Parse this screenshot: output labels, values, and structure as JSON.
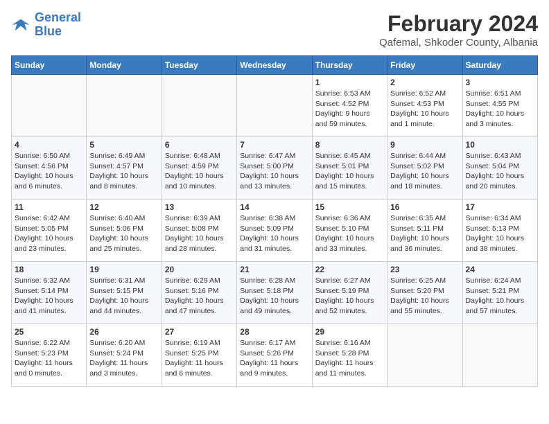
{
  "header": {
    "logo_line1": "General",
    "logo_line2": "Blue",
    "month_year": "February 2024",
    "location": "Qafemal, Shkoder County, Albania"
  },
  "days_of_week": [
    "Sunday",
    "Monday",
    "Tuesday",
    "Wednesday",
    "Thursday",
    "Friday",
    "Saturday"
  ],
  "weeks": [
    [
      {
        "day": "",
        "info": ""
      },
      {
        "day": "",
        "info": ""
      },
      {
        "day": "",
        "info": ""
      },
      {
        "day": "",
        "info": ""
      },
      {
        "day": "1",
        "info": "Sunrise: 6:53 AM\nSunset: 4:52 PM\nDaylight: 9 hours\nand 59 minutes."
      },
      {
        "day": "2",
        "info": "Sunrise: 6:52 AM\nSunset: 4:53 PM\nDaylight: 10 hours\nand 1 minute."
      },
      {
        "day": "3",
        "info": "Sunrise: 6:51 AM\nSunset: 4:55 PM\nDaylight: 10 hours\nand 3 minutes."
      }
    ],
    [
      {
        "day": "4",
        "info": "Sunrise: 6:50 AM\nSunset: 4:56 PM\nDaylight: 10 hours\nand 6 minutes."
      },
      {
        "day": "5",
        "info": "Sunrise: 6:49 AM\nSunset: 4:57 PM\nDaylight: 10 hours\nand 8 minutes."
      },
      {
        "day": "6",
        "info": "Sunrise: 6:48 AM\nSunset: 4:59 PM\nDaylight: 10 hours\nand 10 minutes."
      },
      {
        "day": "7",
        "info": "Sunrise: 6:47 AM\nSunset: 5:00 PM\nDaylight: 10 hours\nand 13 minutes."
      },
      {
        "day": "8",
        "info": "Sunrise: 6:45 AM\nSunset: 5:01 PM\nDaylight: 10 hours\nand 15 minutes."
      },
      {
        "day": "9",
        "info": "Sunrise: 6:44 AM\nSunset: 5:02 PM\nDaylight: 10 hours\nand 18 minutes."
      },
      {
        "day": "10",
        "info": "Sunrise: 6:43 AM\nSunset: 5:04 PM\nDaylight: 10 hours\nand 20 minutes."
      }
    ],
    [
      {
        "day": "11",
        "info": "Sunrise: 6:42 AM\nSunset: 5:05 PM\nDaylight: 10 hours\nand 23 minutes."
      },
      {
        "day": "12",
        "info": "Sunrise: 6:40 AM\nSunset: 5:06 PM\nDaylight: 10 hours\nand 25 minutes."
      },
      {
        "day": "13",
        "info": "Sunrise: 6:39 AM\nSunset: 5:08 PM\nDaylight: 10 hours\nand 28 minutes."
      },
      {
        "day": "14",
        "info": "Sunrise: 6:38 AM\nSunset: 5:09 PM\nDaylight: 10 hours\nand 31 minutes."
      },
      {
        "day": "15",
        "info": "Sunrise: 6:36 AM\nSunset: 5:10 PM\nDaylight: 10 hours\nand 33 minutes."
      },
      {
        "day": "16",
        "info": "Sunrise: 6:35 AM\nSunset: 5:11 PM\nDaylight: 10 hours\nand 36 minutes."
      },
      {
        "day": "17",
        "info": "Sunrise: 6:34 AM\nSunset: 5:13 PM\nDaylight: 10 hours\nand 38 minutes."
      }
    ],
    [
      {
        "day": "18",
        "info": "Sunrise: 6:32 AM\nSunset: 5:14 PM\nDaylight: 10 hours\nand 41 minutes."
      },
      {
        "day": "19",
        "info": "Sunrise: 6:31 AM\nSunset: 5:15 PM\nDaylight: 10 hours\nand 44 minutes."
      },
      {
        "day": "20",
        "info": "Sunrise: 6:29 AM\nSunset: 5:16 PM\nDaylight: 10 hours\nand 47 minutes."
      },
      {
        "day": "21",
        "info": "Sunrise: 6:28 AM\nSunset: 5:18 PM\nDaylight: 10 hours\nand 49 minutes."
      },
      {
        "day": "22",
        "info": "Sunrise: 6:27 AM\nSunset: 5:19 PM\nDaylight: 10 hours\nand 52 minutes."
      },
      {
        "day": "23",
        "info": "Sunrise: 6:25 AM\nSunset: 5:20 PM\nDaylight: 10 hours\nand 55 minutes."
      },
      {
        "day": "24",
        "info": "Sunrise: 6:24 AM\nSunset: 5:21 PM\nDaylight: 10 hours\nand 57 minutes."
      }
    ],
    [
      {
        "day": "25",
        "info": "Sunrise: 6:22 AM\nSunset: 5:23 PM\nDaylight: 11 hours\nand 0 minutes."
      },
      {
        "day": "26",
        "info": "Sunrise: 6:20 AM\nSunset: 5:24 PM\nDaylight: 11 hours\nand 3 minutes."
      },
      {
        "day": "27",
        "info": "Sunrise: 6:19 AM\nSunset: 5:25 PM\nDaylight: 11 hours\nand 6 minutes."
      },
      {
        "day": "28",
        "info": "Sunrise: 6:17 AM\nSunset: 5:26 PM\nDaylight: 11 hours\nand 9 minutes."
      },
      {
        "day": "29",
        "info": "Sunrise: 6:16 AM\nSunset: 5:28 PM\nDaylight: 11 hours\nand 11 minutes."
      },
      {
        "day": "",
        "info": ""
      },
      {
        "day": "",
        "info": ""
      }
    ]
  ]
}
